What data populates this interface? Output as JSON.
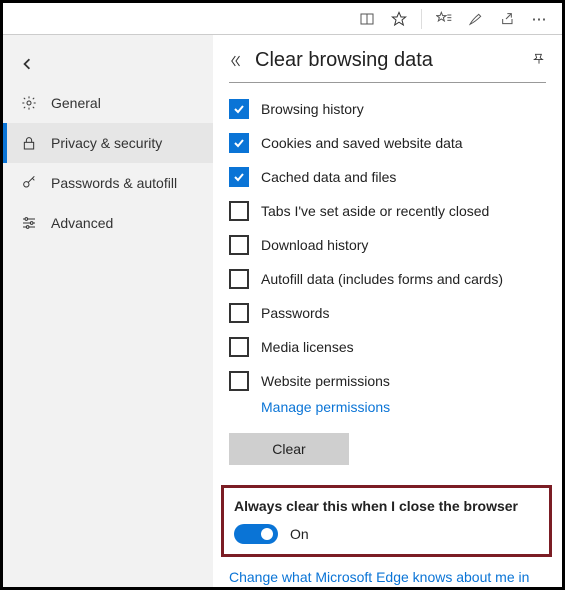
{
  "toolbar": {
    "reading_icon": "reading-view",
    "star_icon": "star",
    "favlist_icon": "favorites-list",
    "pen_icon": "pen",
    "share_icon": "share",
    "more_icon": "more"
  },
  "sidebar": {
    "items": [
      {
        "label": "General",
        "icon": "gear"
      },
      {
        "label": "Privacy & security",
        "icon": "lock"
      },
      {
        "label": "Passwords & autofill",
        "icon": "key"
      },
      {
        "label": "Advanced",
        "icon": "sliders"
      }
    ],
    "active_index": 1
  },
  "panel": {
    "title": "Clear browsing data",
    "options": [
      {
        "label": "Browsing history",
        "checked": true
      },
      {
        "label": "Cookies and saved website data",
        "checked": true
      },
      {
        "label": "Cached data and files",
        "checked": true
      },
      {
        "label": "Tabs I've set aside or recently closed",
        "checked": false
      },
      {
        "label": "Download history",
        "checked": false
      },
      {
        "label": "Autofill data (includes forms and cards)",
        "checked": false
      },
      {
        "label": "Passwords",
        "checked": false
      },
      {
        "label": "Media licenses",
        "checked": false
      },
      {
        "label": "Website permissions",
        "checked": false
      }
    ],
    "manage_permissions": "Manage permissions",
    "clear_button": "Clear",
    "always_clear_title": "Always clear this when I close the browser",
    "toggle_state_label": "On",
    "toggle_on": true,
    "footer_link": "Change what Microsoft Edge knows about me in"
  }
}
